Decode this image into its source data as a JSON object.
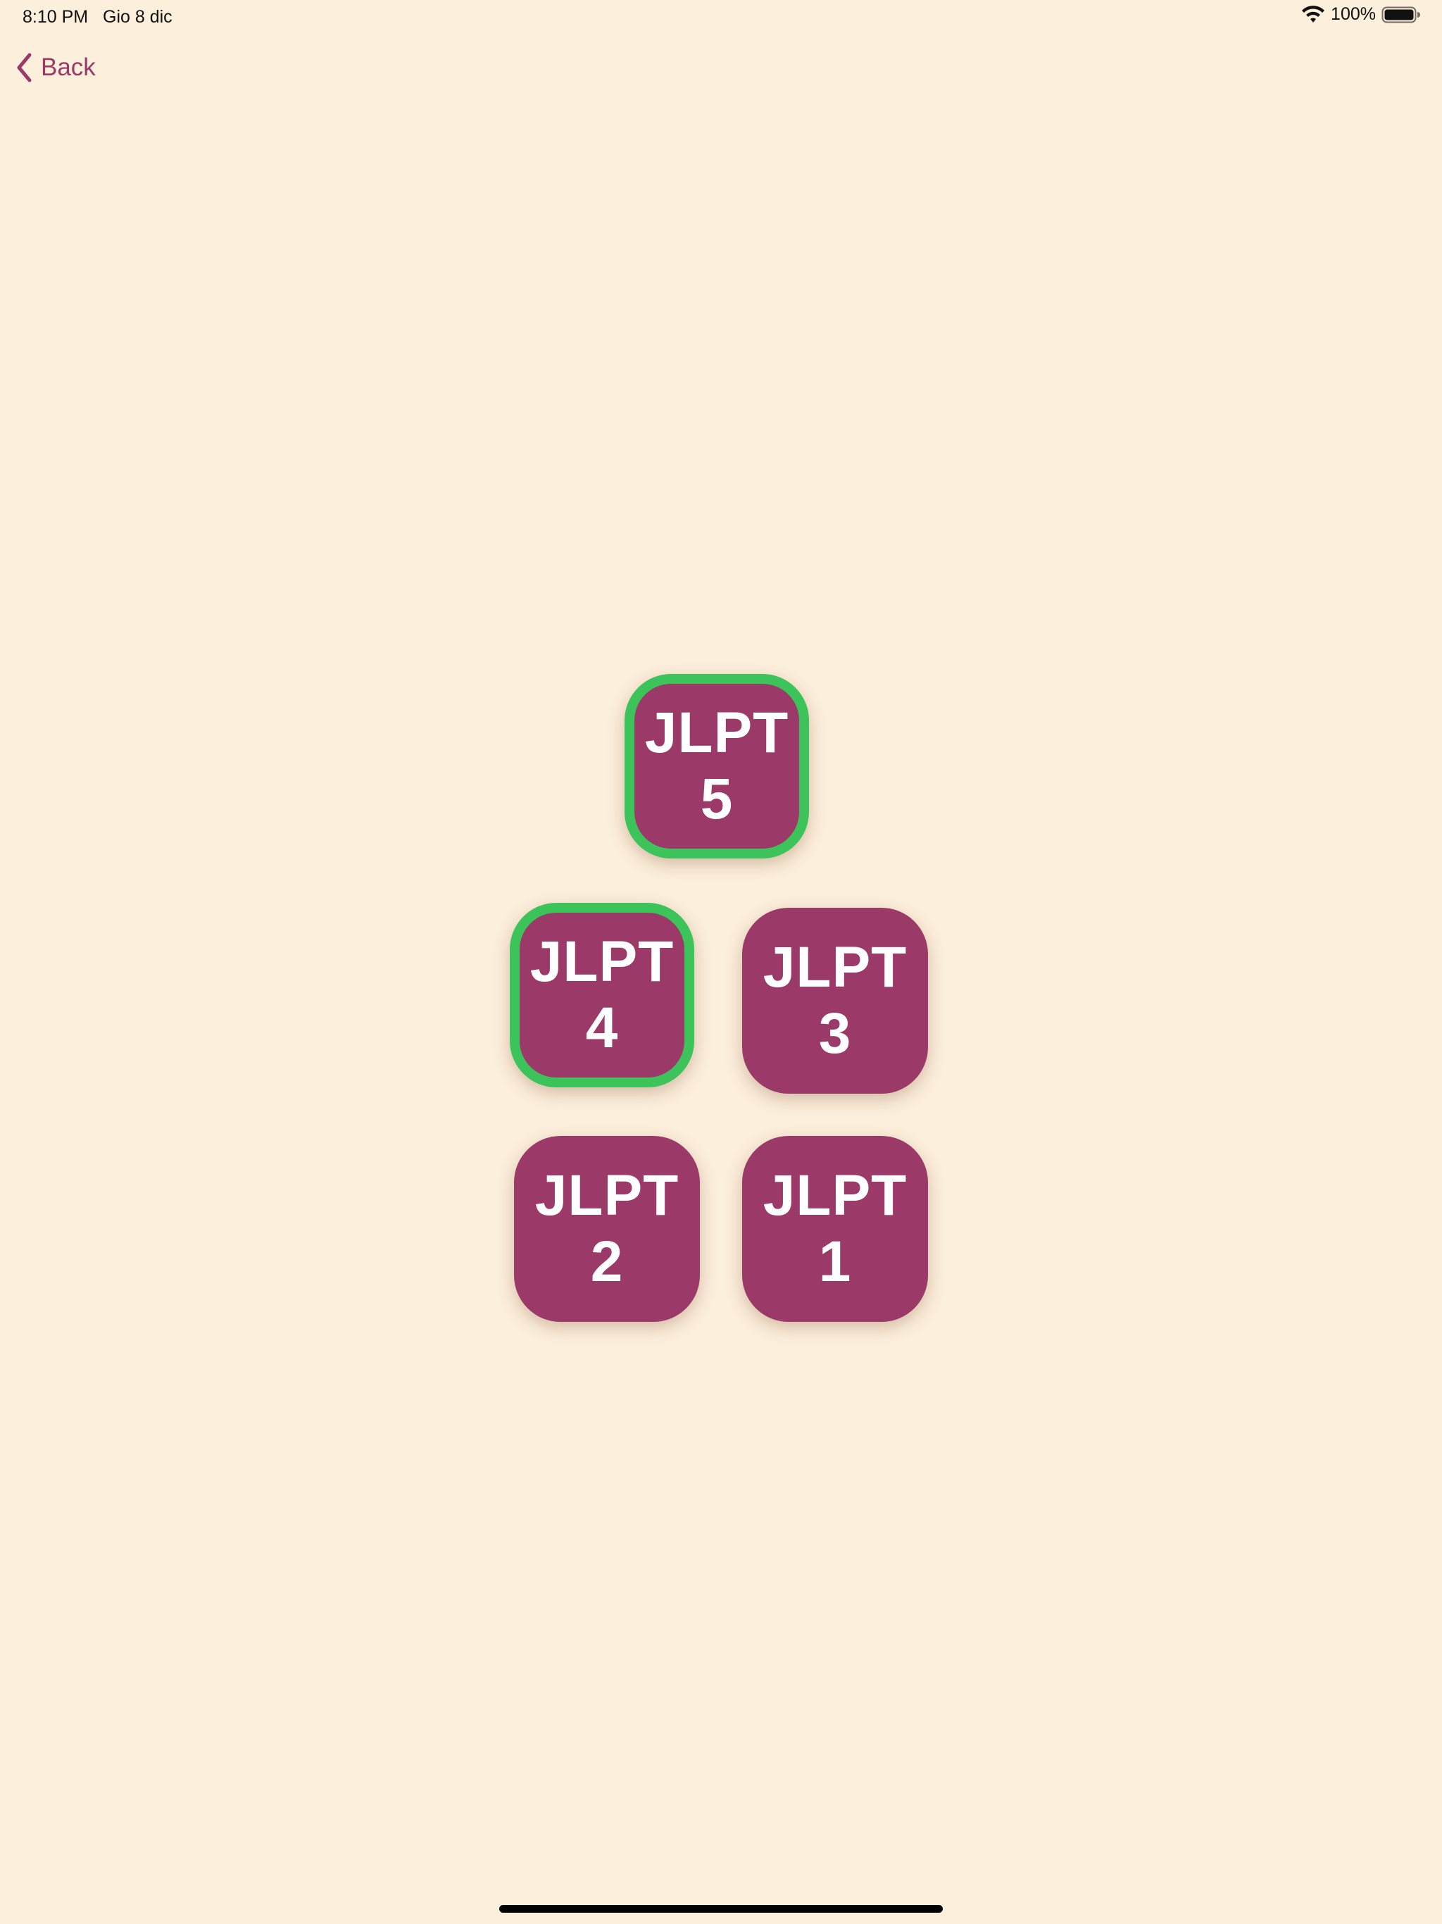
{
  "status_bar": {
    "time": "8:10 PM",
    "date": "Gio 8 dic",
    "battery_percent": "100%",
    "wifi_icon": "wifi-icon",
    "battery_icon": "battery-full-icon"
  },
  "nav": {
    "back_label": "Back",
    "back_icon": "chevron-left-icon"
  },
  "levels": [
    {
      "word": "JLPT",
      "number": "5",
      "completed": true
    },
    {
      "word": "JLPT",
      "number": "4",
      "completed": true
    },
    {
      "word": "JLPT",
      "number": "3",
      "completed": false
    },
    {
      "word": "JLPT",
      "number": "2",
      "completed": false
    },
    {
      "word": "JLPT",
      "number": "1",
      "completed": false
    }
  ],
  "colors": {
    "background": "#fcefdc",
    "tile": "#9b3a68",
    "completed_border": "#3cc45a",
    "accent": "#9b3a67"
  }
}
